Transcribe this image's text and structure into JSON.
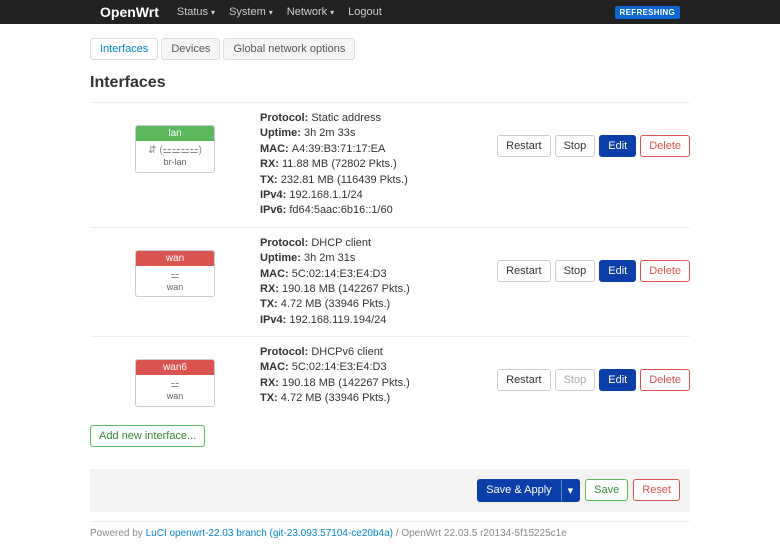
{
  "header": {
    "brand": "OpenWrt",
    "menu": [
      "Status",
      "System",
      "Network",
      "Logout"
    ],
    "refreshing": "REFRESHING"
  },
  "tabs": {
    "items": [
      "Interfaces",
      "Devices",
      "Global network options"
    ],
    "active": 0
  },
  "page": {
    "title": "Interfaces"
  },
  "interfaces": [
    {
      "name": "lan",
      "status_color": "green",
      "device_glyph": "⇵ (⚍⚍⚍⚍)",
      "device": "br-lan",
      "info": [
        {
          "k": "Protocol",
          "v": "Static address"
        },
        {
          "k": "Uptime",
          "v": "3h 2m 33s"
        },
        {
          "k": "MAC",
          "v": "A4:39:B3:71:17:EA"
        },
        {
          "k": "RX",
          "v": "11.88 MB (72802 Pkts.)"
        },
        {
          "k": "TX",
          "v": "232.81 MB (116439 Pkts.)"
        },
        {
          "k": "IPv4",
          "v": "192.168.1.1/24"
        },
        {
          "k": "IPv6",
          "v": "fd64:5aac:6b16::1/60"
        }
      ],
      "stop_enabled": true
    },
    {
      "name": "wan",
      "status_color": "red",
      "device_glyph": "⚍",
      "device": "wan",
      "info": [
        {
          "k": "Protocol",
          "v": "DHCP client"
        },
        {
          "k": "Uptime",
          "v": "3h 2m 31s"
        },
        {
          "k": "MAC",
          "v": "5C:02:14:E3:E4:D3"
        },
        {
          "k": "RX",
          "v": "190.18 MB (142267 Pkts.)"
        },
        {
          "k": "TX",
          "v": "4.72 MB (33946 Pkts.)"
        },
        {
          "k": "IPv4",
          "v": "192.168.119.194/24"
        }
      ],
      "stop_enabled": true
    },
    {
      "name": "wan6",
      "status_color": "red",
      "device_glyph": "⚍",
      "device": "wan",
      "info": [
        {
          "k": "Protocol",
          "v": "DHCPv6 client"
        },
        {
          "k": "MAC",
          "v": "5C:02:14:E3:E4:D3"
        },
        {
          "k": "RX",
          "v": "190.18 MB (142267 Pkts.)"
        },
        {
          "k": "TX",
          "v": "4.72 MB (33946 Pkts.)"
        }
      ],
      "stop_enabled": false
    }
  ],
  "actions": {
    "restart": "Restart",
    "stop": "Stop",
    "edit": "Edit",
    "delete": "Delete",
    "add": "Add new interface...",
    "save_apply": "Save & Apply",
    "save": "Save",
    "reset": "Reset"
  },
  "footer": {
    "prefix": "Powered by ",
    "link": "LuCI openwrt-22.03 branch (git-23.093.57104-ce20b4a)",
    "suffix": " / OpenWrt 22.03.5 r20134-5f15225c1e"
  }
}
